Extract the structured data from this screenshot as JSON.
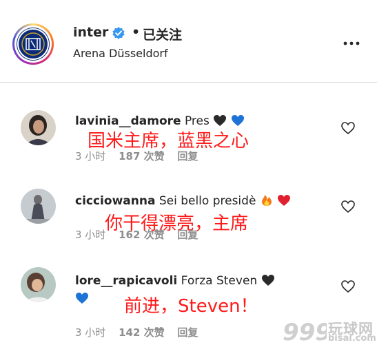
{
  "post": {
    "username": "inter",
    "dot": "•",
    "follow_status": "已关注",
    "location": "Arena Düsseldorf"
  },
  "comments": [
    {
      "username": "lavinia__damore",
      "text": "Pres",
      "annotation": "国米主席，蓝黑之心",
      "time": "3 小时",
      "likes": "187 次赞",
      "reply": "回复"
    },
    {
      "username": "cicciowanna",
      "text": "Sei bello presidè",
      "annotation": "你干得漂亮，主席",
      "time": "3 小时",
      "likes": "162 次赞",
      "reply": "回复"
    },
    {
      "username": "lore__rapicavoli",
      "text": "Forza Steven",
      "annotation": "前进，Steven！",
      "time": "3 小时",
      "likes": "142 次赞",
      "reply": "回复"
    }
  ],
  "watermark": {
    "text": "玩球网",
    "sub": "bisai.com"
  },
  "colors": {
    "annotation": "#ff1a1a",
    "verified": "#3897f0",
    "meta": "#8e8e8e",
    "inter_blue": "#0b2a78"
  }
}
